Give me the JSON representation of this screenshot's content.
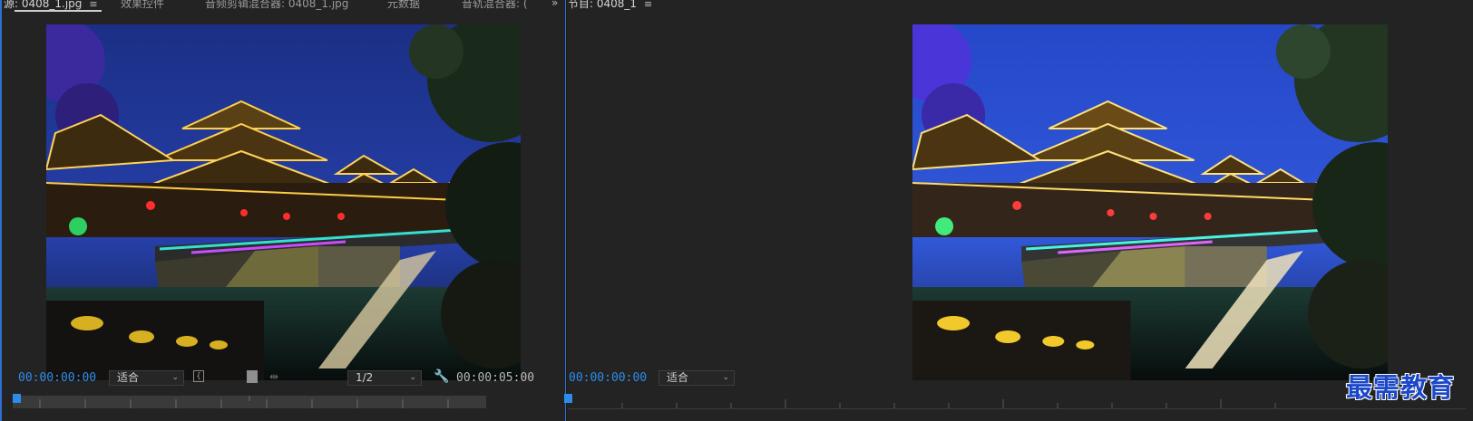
{
  "source_panel": {
    "tabs": [
      {
        "label": "源: 0408_1.jpg",
        "active": true
      },
      {
        "label": "效果控件",
        "active": false
      },
      {
        "label": "音频剪辑混合器: 0408_1.jpg",
        "active": false
      },
      {
        "label": "元数据",
        "active": false
      },
      {
        "label": "音轨混合器: (",
        "active": false
      }
    ],
    "menu_icon": "≡",
    "overflow_icon": "»",
    "timecode_current": "00:00:00:00",
    "zoom_select": "适合",
    "resolution_select": "1/2",
    "timecode_duration": "00:00:05:00"
  },
  "program_panel": {
    "tab": {
      "label": "节目: 0408_1",
      "active": true
    },
    "menu_icon": "≡",
    "timecode_current": "00:00:00:00",
    "zoom_select": "适合"
  },
  "watermark": "最需教育",
  "colors": {
    "accent": "#2d8ceb",
    "panel_bg": "#232323",
    "focus_border": "#2f6fd1",
    "watermark": "#1b47c8"
  }
}
